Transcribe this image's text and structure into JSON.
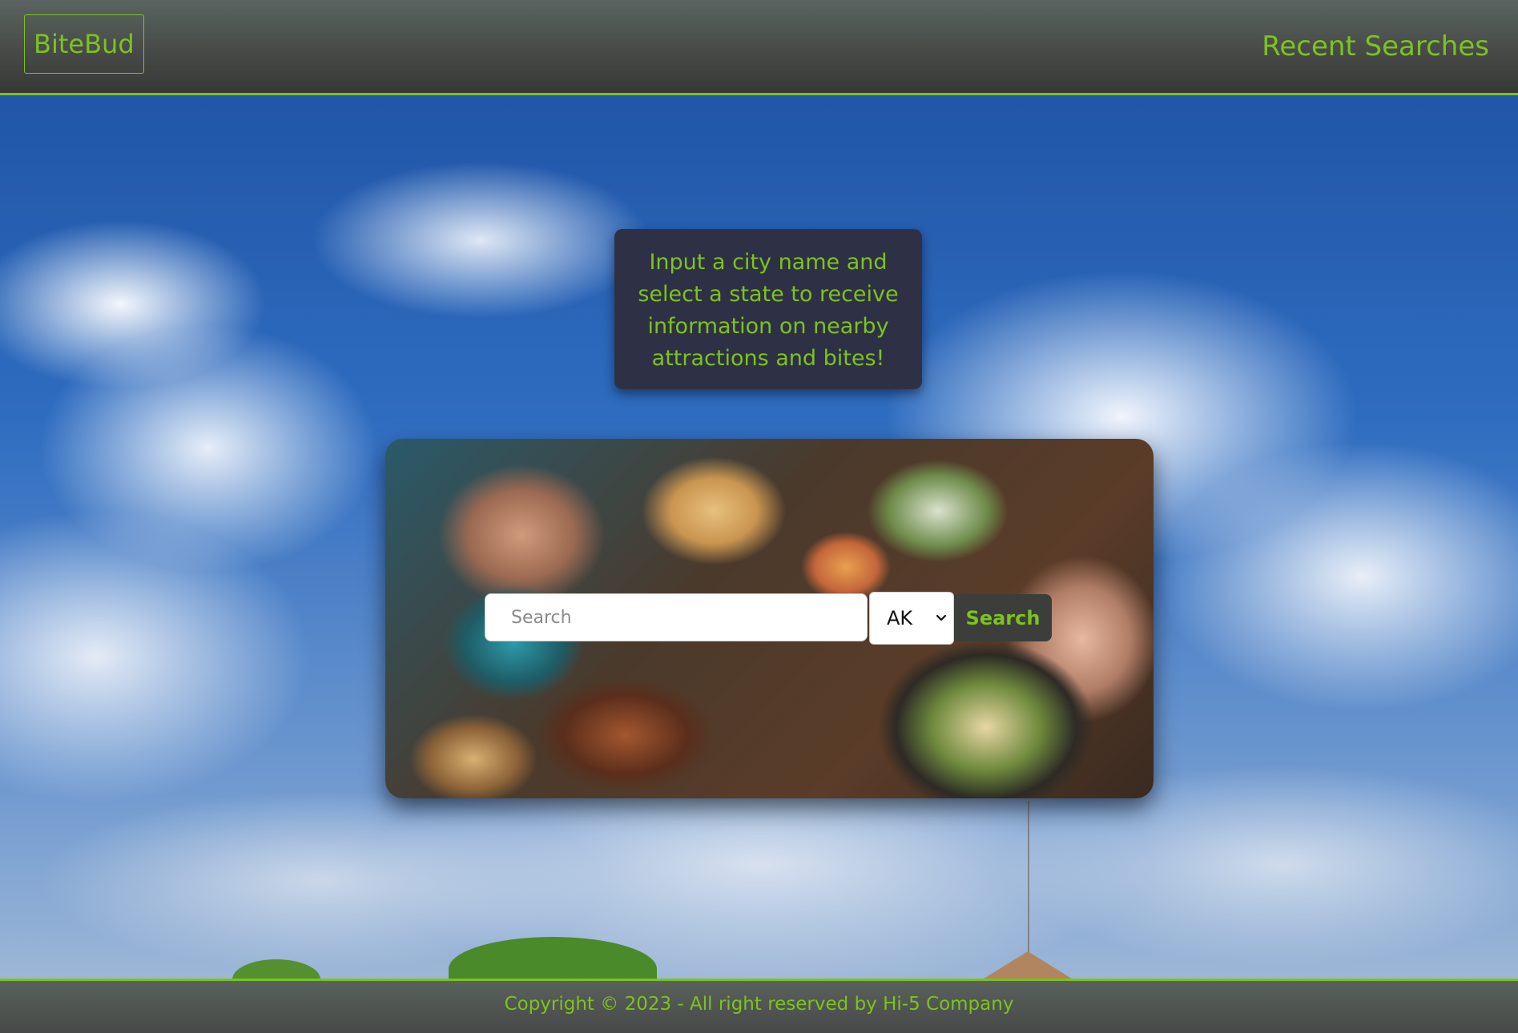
{
  "header": {
    "logo": "BiteBud",
    "recent_searches": "Recent Searches"
  },
  "info": {
    "text": "Input a city name and select a state to receive information on nearby attractions and bites!"
  },
  "search": {
    "placeholder": "Search",
    "value": "",
    "state_selected": "AK",
    "button_label": "Search"
  },
  "footer": {
    "copyright": "Copyright © 2023 - All right reserved by Hi-5 Company"
  },
  "colors": {
    "accent": "#7dc21f",
    "header_bg": "#474b48",
    "info_bg": "#2e3145"
  },
  "icons": {
    "select_arrow": "chevron-down-icon"
  }
}
